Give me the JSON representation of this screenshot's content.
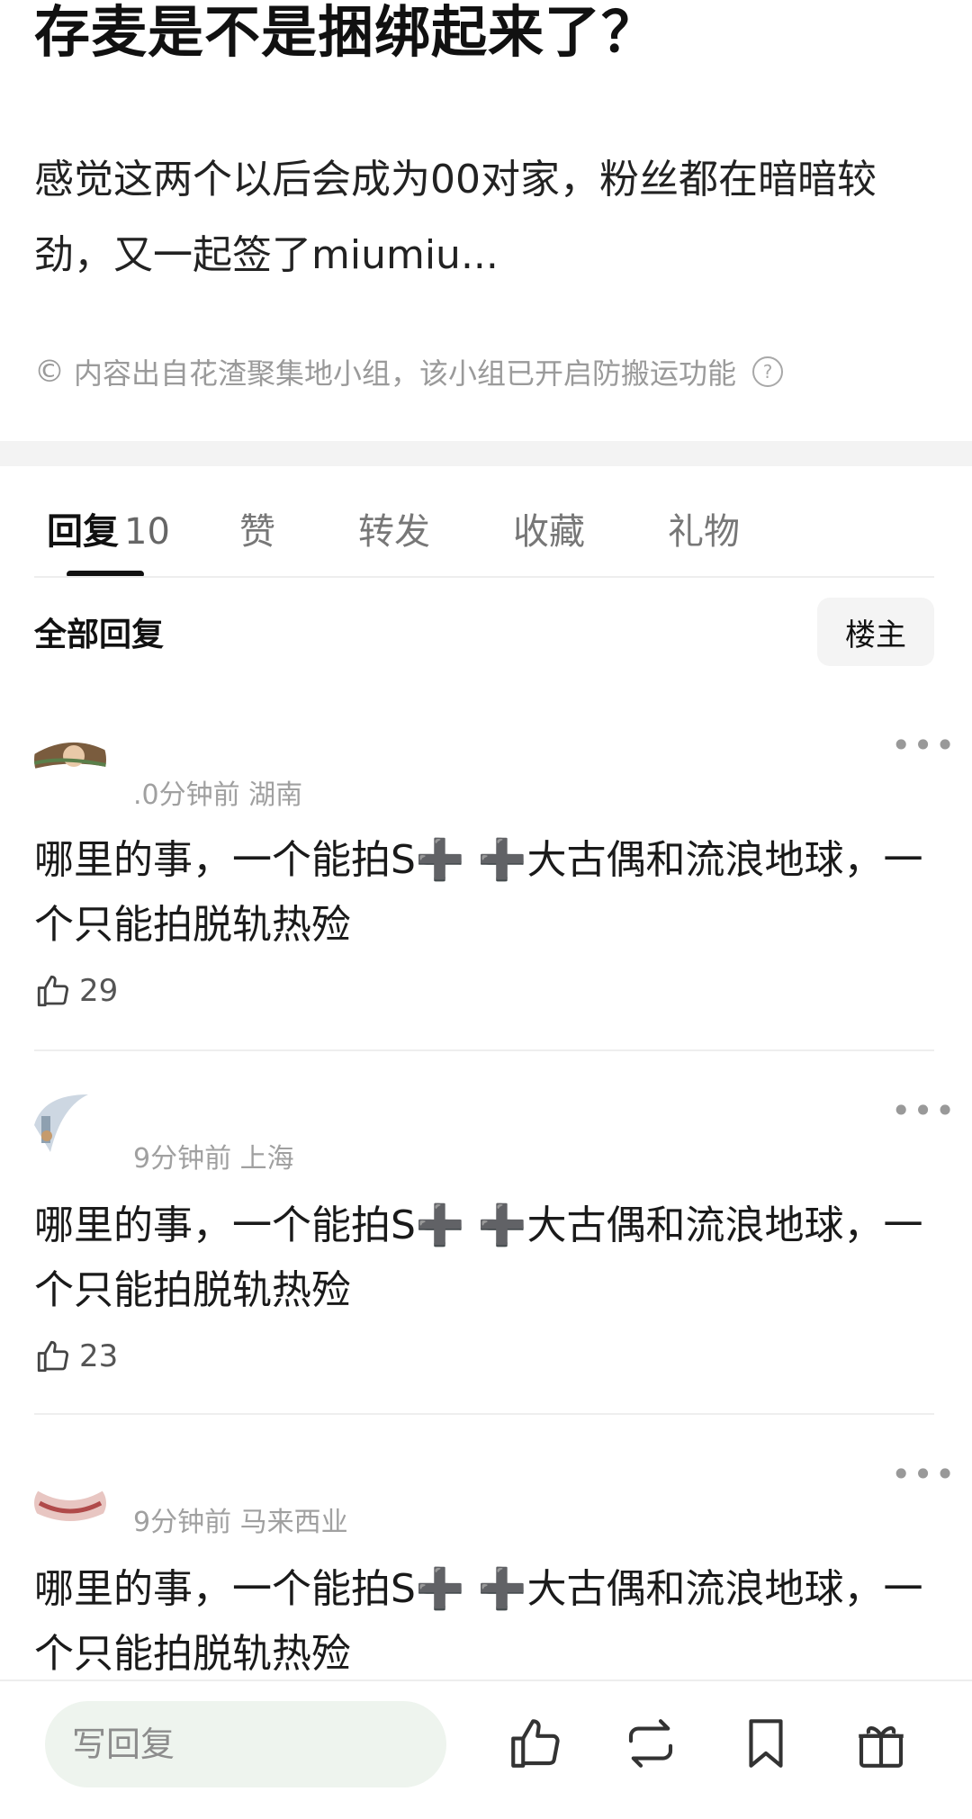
{
  "post": {
    "title": "存麦是不是捆绑起来了？",
    "body": "感觉这两个以后会成为00对家，粉丝都在暗暗较劲，又一起签了miumiu...",
    "source_icon": "©",
    "source_text": "内容出自花渣聚集地小组，该小组已开启防搬运功能",
    "source_help": "?"
  },
  "tabs": [
    {
      "label": "回复",
      "count": "10",
      "active": true
    },
    {
      "label": "赞"
    },
    {
      "label": "转发"
    },
    {
      "label": "收藏"
    },
    {
      "label": "礼物"
    }
  ],
  "section": {
    "title": "全部回复",
    "owner_filter": "楼主"
  },
  "comments": [
    {
      "time": ".0分钟前",
      "location": "湖南",
      "text": "哪里的事，一个能拍S➕ ➕大古偶和流浪地球，一个只能拍脱轨热殓",
      "likes": "29",
      "more": "•••"
    },
    {
      "time": "9分钟前",
      "location": "上海",
      "text": "哪里的事，一个能拍S➕ ➕大古偶和流浪地球，一个只能拍脱轨热殓",
      "likes": "23",
      "more": "•••"
    },
    {
      "time": "9分钟前",
      "location": "马来西业",
      "text": "哪里的事，一个能拍S➕ ➕大古偶和流浪地球，一个只能拍脱轨热殓",
      "more": "•••"
    }
  ],
  "bottom_bar": {
    "reply_placeholder": "写回复"
  },
  "icons": [
    "copyright-icon",
    "help-icon",
    "more-icon",
    "thumbs-up-icon",
    "repost-icon",
    "bookmark-icon",
    "gift-icon"
  ],
  "colors": {
    "text": "#111111",
    "muted": "#9a9a9a",
    "input_bg": "#eef4ee",
    "divider": "#eeeeee"
  }
}
